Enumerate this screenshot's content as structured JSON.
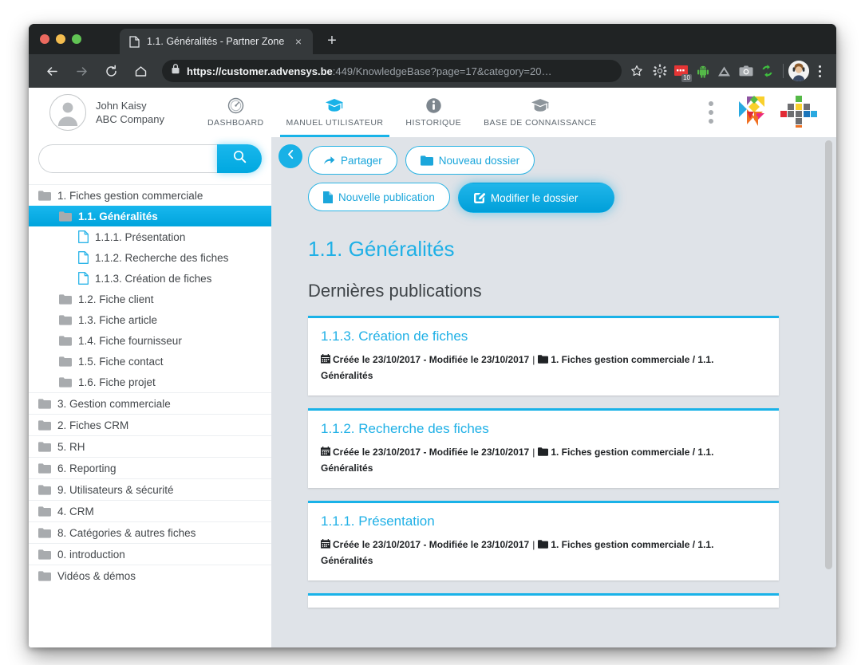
{
  "browser": {
    "tab": {
      "title": "1.1. Généralités - Partner Zone",
      "favicon": "page-icon",
      "close": "×"
    },
    "new_tab": "+",
    "nav": {
      "back": "←",
      "forward": "→",
      "reload": "⟳",
      "home": "⌂"
    },
    "omnibox": {
      "lock": "lock-icon",
      "url_bold": "https://customer.advensys.be",
      "url_rest": ":449/KnowledgeBase?page=17&category=20…"
    },
    "extensions": [
      {
        "name": "bookmark-star-icon",
        "badge": ""
      },
      {
        "name": "gear-icon",
        "badge": ""
      },
      {
        "name": "red-recorder-icon",
        "badge": "10"
      },
      {
        "name": "android-icon",
        "badge": ""
      },
      {
        "name": "drive-triangle-icon",
        "badge": ""
      },
      {
        "name": "camera-icon",
        "badge": ""
      },
      {
        "name": "sync-arrows-icon",
        "badge": ""
      }
    ],
    "profile": "avatar",
    "menu": "⋮"
  },
  "app": {
    "user": {
      "name": "John Kaisy",
      "company": "ABC Company"
    },
    "nav_tabs": [
      {
        "label": "DASHBOARD",
        "icon": "gauge-icon",
        "active": false
      },
      {
        "label": "MANUEL UTILISATEUR",
        "icon": "graduation-cap-icon",
        "active": true
      },
      {
        "label": "HISTORIQUE",
        "icon": "info-circle-icon",
        "active": false
      },
      {
        "label": "BASE DE CONNAISSANCE",
        "icon": "graduation-cap-icon",
        "active": false
      }
    ],
    "brand": {
      "dots": "vertical-dots-icon",
      "logo1": "tangram-logo",
      "logo2": "dot-grid-logo"
    }
  },
  "sidebar": {
    "search": {
      "value": "",
      "placeholder": "",
      "button_icon": "search-icon"
    },
    "tree": [
      {
        "label": "1. Fiches gestion commerciale",
        "level": 0,
        "type": "folder",
        "selected": false
      },
      {
        "label": "1.1. Généralités",
        "level": 1,
        "type": "folder",
        "selected": true
      },
      {
        "label": "1.1.1. Présentation",
        "level": 2,
        "type": "doc",
        "selected": false
      },
      {
        "label": "1.1.2. Recherche des fiches",
        "level": 2,
        "type": "doc",
        "selected": false
      },
      {
        "label": "1.1.3. Création de fiches",
        "level": 2,
        "type": "doc",
        "selected": false
      },
      {
        "label": "1.2. Fiche client",
        "level": 1,
        "type": "folder",
        "selected": false
      },
      {
        "label": "1.3. Fiche article",
        "level": 1,
        "type": "folder",
        "selected": false
      },
      {
        "label": "1.4. Fiche fournisseur",
        "level": 1,
        "type": "folder",
        "selected": false
      },
      {
        "label": "1.5. Fiche contact",
        "level": 1,
        "type": "folder",
        "selected": false
      },
      {
        "label": "1.6. Fiche projet",
        "level": 1,
        "type": "folder",
        "selected": false
      },
      {
        "label": "3. Gestion commerciale",
        "level": 0,
        "type": "folder",
        "selected": false
      },
      {
        "label": "2. Fiches CRM",
        "level": 0,
        "type": "folder",
        "selected": false
      },
      {
        "label": "5. RH",
        "level": 0,
        "type": "folder",
        "selected": false
      },
      {
        "label": "6. Reporting",
        "level": 0,
        "type": "folder",
        "selected": false
      },
      {
        "label": "9. Utilisateurs & sécurité",
        "level": 0,
        "type": "folder",
        "selected": false
      },
      {
        "label": "4. CRM",
        "level": 0,
        "type": "folder",
        "selected": false
      },
      {
        "label": "8. Catégories & autres fiches",
        "level": 0,
        "type": "folder",
        "selected": false
      },
      {
        "label": "0. introduction",
        "level": 0,
        "type": "folder",
        "selected": false
      },
      {
        "label": "Vidéos & démos",
        "level": 0,
        "type": "folder",
        "selected": false
      }
    ]
  },
  "main": {
    "collapse_icon": "chevron-left-icon",
    "actions": [
      {
        "label": "Partager",
        "icon": "share-arrow-icon",
        "primary": false
      },
      {
        "label": "Nouveau dossier",
        "icon": "folder-icon",
        "primary": false
      },
      {
        "label": "Nouvelle publication",
        "icon": "file-icon",
        "primary": false
      },
      {
        "label": "Modifier le dossier",
        "icon": "edit-square-icon",
        "primary": true
      }
    ],
    "page_title": "1.1. Généralités",
    "section_title": "Dernières publications",
    "publications": [
      {
        "title": "1.1.3. Création de fiches",
        "created_label": "Créée le",
        "created_date": "23/10/2017",
        "modified_label": "- Modifiée le",
        "modified_date": "23/10/2017",
        "path": "1. Fiches gestion commerciale / 1.1. Généralités"
      },
      {
        "title": "1.1.2. Recherche des fiches",
        "created_label": "Créée le",
        "created_date": "23/10/2017",
        "modified_label": "- Modifiée le",
        "modified_date": "23/10/2017",
        "path": "1. Fiches gestion commerciale / 1.1. Généralités"
      },
      {
        "title": "1.1.1. Présentation",
        "created_label": "Créée le",
        "created_date": "23/10/2017",
        "modified_label": "- Modifiée le",
        "modified_date": "23/10/2017",
        "path": "1. Fiches gestion commerciale / 1.1. Généralités"
      }
    ]
  },
  "colors": {
    "accent": "#18b2e8",
    "accent_dark": "#00a4dd",
    "page_bg": "#dfe3e8",
    "chrome_bg": "#202324",
    "toolbar_bg": "#35393b"
  }
}
